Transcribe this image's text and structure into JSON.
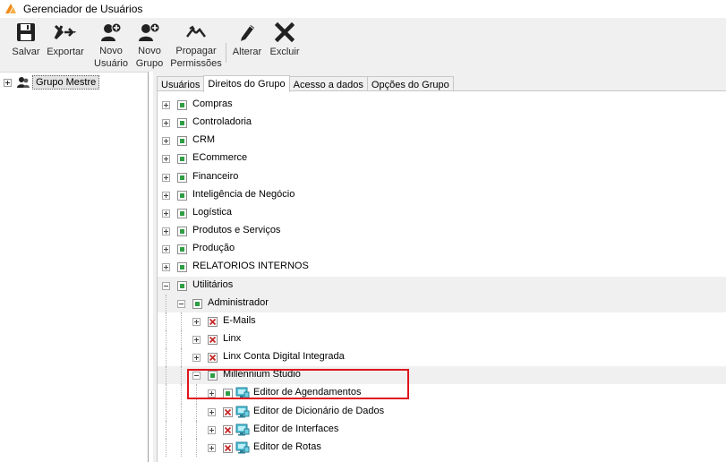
{
  "window": {
    "title": "Gerenciador de Usuários"
  },
  "toolbar": {
    "buttons": [
      {
        "label": "Salvar",
        "icon": "save-icon"
      },
      {
        "label": "Exportar",
        "icon": "export-icon"
      },
      {
        "label": "Novo Usuário",
        "icon": "new-user-icon"
      },
      {
        "label": "Novo Grupo",
        "icon": "new-group-icon"
      },
      {
        "label": "Propagar Permissões",
        "icon": "propagate-icon"
      },
      {
        "label": "Alterar",
        "icon": "pencil-icon"
      },
      {
        "label": "Excluir",
        "icon": "delete-icon"
      }
    ]
  },
  "left_tree": {
    "root": {
      "label": "Grupo Mestre",
      "icon": "group-icon"
    }
  },
  "tabs": [
    {
      "label": "Usuários",
      "active": false
    },
    {
      "label": "Direitos do Grupo",
      "active": true
    },
    {
      "label": "Acesso a dados",
      "active": false
    },
    {
      "label": "Opções do Grupo",
      "active": false
    }
  ],
  "rights_tree": [
    {
      "label": "Compras",
      "level": 0,
      "expander": "plus",
      "check": "ok"
    },
    {
      "label": "Controladoria",
      "level": 0,
      "expander": "plus",
      "check": "ok"
    },
    {
      "label": "CRM",
      "level": 0,
      "expander": "plus",
      "check": "ok"
    },
    {
      "label": "ECommerce",
      "level": 0,
      "expander": "plus",
      "check": "ok"
    },
    {
      "label": "Financeiro",
      "level": 0,
      "expander": "plus",
      "check": "ok"
    },
    {
      "label": "Inteligência de Negócio",
      "level": 0,
      "expander": "plus",
      "check": "ok"
    },
    {
      "label": "Logística",
      "level": 0,
      "expander": "plus",
      "check": "ok"
    },
    {
      "label": "Produtos e Serviços",
      "level": 0,
      "expander": "plus",
      "check": "ok"
    },
    {
      "label": "Produção",
      "level": 0,
      "expander": "plus",
      "check": "ok"
    },
    {
      "label": "RELATORIOS INTERNOS",
      "level": 0,
      "expander": "plus",
      "check": "ok"
    },
    {
      "label": "Utilitários",
      "level": 0,
      "expander": "minus",
      "check": "ok",
      "highlight": true
    },
    {
      "label": "Administrador",
      "level": 1,
      "expander": "minus",
      "check": "ok",
      "highlight": true
    },
    {
      "label": "E-Mails",
      "level": 2,
      "expander": "plus",
      "check": "no"
    },
    {
      "label": "Linx",
      "level": 2,
      "expander": "plus",
      "check": "no"
    },
    {
      "label": "Linx Conta Digital Integrada",
      "level": 2,
      "expander": "plus",
      "check": "no"
    },
    {
      "label": "Millennium Studio",
      "level": 2,
      "expander": "minus",
      "check": "ok",
      "highlight": true
    },
    {
      "label": "Editor de Agendamentos",
      "level": 3,
      "expander": "plus",
      "check": "ok",
      "object": true
    },
    {
      "label": "Editor de Dicionário de Dados",
      "level": 3,
      "expander": "plus",
      "check": "no",
      "object": true
    },
    {
      "label": "Editor de Interfaces",
      "level": 3,
      "expander": "plus",
      "check": "no",
      "object": true
    },
    {
      "label": "Editor de Rotas",
      "level": 3,
      "expander": "plus",
      "check": "no",
      "object": true
    }
  ],
  "colors": {
    "check_ok": "#2f9e44",
    "check_no": "#c62828",
    "highlight_box": "#e0151b"
  }
}
